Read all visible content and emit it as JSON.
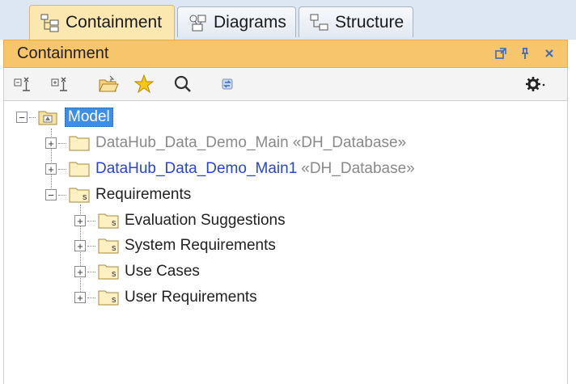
{
  "tabs": [
    {
      "label": "Containment",
      "icon": "containment-icon",
      "active": true
    },
    {
      "label": "Diagrams",
      "icon": "diagrams-icon",
      "active": false
    },
    {
      "label": "Structure",
      "icon": "structure-icon",
      "active": false
    }
  ],
  "panel": {
    "title": "Containment",
    "buttons": [
      "restore-icon",
      "pin-icon",
      "close-icon"
    ]
  },
  "toolbar": {
    "icons": [
      "collapse-all-icon",
      "expand-all-icon",
      "open-folder-icon",
      "favorite-star-icon",
      "search-icon",
      "sync-icon",
      "settings-gear-icon"
    ]
  },
  "tree": {
    "root": {
      "label": "Model",
      "expanded": true,
      "selected": true
    },
    "children": [
      {
        "name": "DataHub_Data_Demo_Main",
        "stereotype": "«DH_Database»",
        "expanded": false,
        "style": "muted"
      },
      {
        "name": "DataHub_Data_Demo_Main1",
        "stereotype": "«DH_Database»",
        "expanded": false,
        "style": "link"
      },
      {
        "name": "Requirements",
        "expanded": true,
        "children": [
          {
            "name": "Evaluation Suggestions",
            "expanded": false
          },
          {
            "name": "System Requirements",
            "expanded": false
          },
          {
            "name": "Use Cases",
            "expanded": false
          },
          {
            "name": "User Requirements",
            "expanded": false
          }
        ]
      }
    ]
  },
  "colors": {
    "tab_active": "#fbe7b0",
    "panel_header": "#f7c56b",
    "selection": "#3d8ee8",
    "link_text": "#2a44d4",
    "muted_text": "#8a8a8a"
  }
}
